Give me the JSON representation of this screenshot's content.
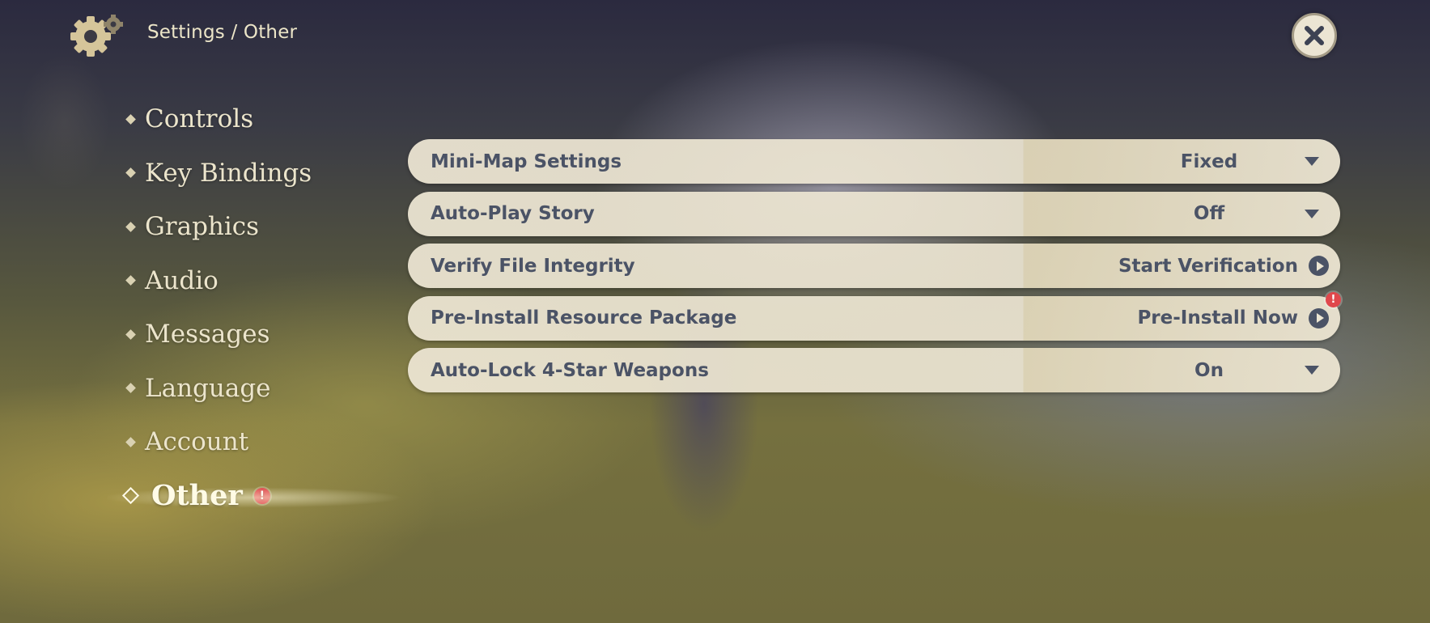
{
  "header": {
    "breadcrumb": "Settings / Other",
    "icons": {
      "settings": "gear-icon",
      "close": "close-icon"
    }
  },
  "sidebar": {
    "items": [
      {
        "label": "Controls",
        "active": false
      },
      {
        "label": "Key Bindings",
        "active": false
      },
      {
        "label": "Graphics",
        "active": false
      },
      {
        "label": "Audio",
        "active": false
      },
      {
        "label": "Messages",
        "active": false
      },
      {
        "label": "Language",
        "active": false
      },
      {
        "label": "Account",
        "active": false
      },
      {
        "label": "Other",
        "active": true,
        "alert": "!"
      }
    ]
  },
  "settings": {
    "rows": [
      {
        "label": "Mini-Map Settings",
        "value": "Fixed",
        "control": "dropdown"
      },
      {
        "label": "Auto-Play Story",
        "value": "Off",
        "control": "dropdown"
      },
      {
        "label": "Verify File Integrity",
        "value": "Start Verification",
        "control": "action"
      },
      {
        "label": "Pre-Install Resource Package",
        "value": "Pre-Install Now",
        "control": "action",
        "alert": "!"
      },
      {
        "label": "Auto-Lock 4-Star Weapons",
        "value": "On",
        "control": "dropdown"
      }
    ]
  },
  "colors": {
    "panel": "#ece5d2",
    "text_dark": "#4b5366",
    "text_light": "#ece5cc",
    "alert": "#e0474c"
  }
}
